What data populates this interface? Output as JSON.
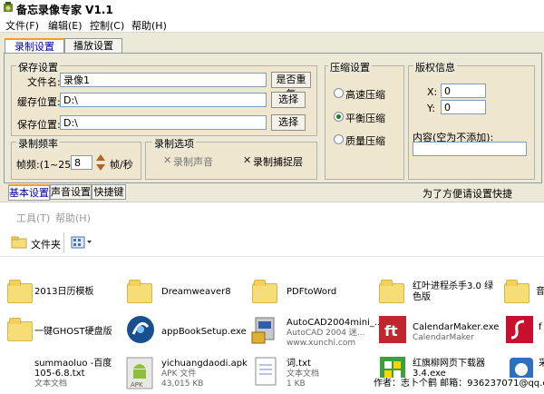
{
  "app": {
    "title": "备忘录像专家 V1.1",
    "menu": [
      "文件(F)",
      "编辑(E)",
      "控制(C)",
      "帮助(H)"
    ],
    "tabs": [
      "录制设置",
      "播放设置"
    ],
    "save_settings": {
      "group_title": "保存设置",
      "filename_label": "文件名:",
      "filename_value": "录像1",
      "rename_button": "是否重复",
      "cache_label": "缓存位置:",
      "cache_value": "D:\\",
      "cache_browse": "选择",
      "save_label": "保存位置:",
      "save_value": "D:\\",
      "save_browse": "选择"
    },
    "framerate": {
      "group_title": "录制频率",
      "label": "帧频:(1~25)",
      "value": "8",
      "unit": "帧/秒"
    },
    "record_options": {
      "group_title": "录制选项",
      "sound": "录制声音",
      "cursor": "录制捕捉层"
    },
    "compression": {
      "group_title": "压缩设置",
      "options": [
        "高速压缩",
        "平衡压缩",
        "质量压缩"
      ],
      "selected": "平衡压缩"
    },
    "copyright": {
      "group_title": "版权信息",
      "x_label": "X:",
      "x_value": "0",
      "y_label": "Y:",
      "y_value": "0",
      "content_label": "内容(空为不添加):",
      "content_value": ""
    },
    "subtabs": [
      "基本设置",
      "声音设置",
      "快捷键"
    ],
    "hint": "为了方便请设置快捷键！！！"
  },
  "explorer": {
    "menu": [
      "工具(T)",
      "帮助(H)"
    ],
    "toolbar": {
      "folders": "文件夹"
    },
    "rows": [
      [
        {
          "name": "2013日历模板",
          "sub": "",
          "icon": "folder-icon"
        },
        {
          "name": "Dreamweaver8",
          "sub": "",
          "icon": "folder-icon"
        },
        {
          "name": "PDFtoWord",
          "sub": "",
          "icon": "folder-icon"
        },
        {
          "name": "红叶进程杀手3.0 绿色版",
          "sub": "",
          "icon": "folder-icon"
        },
        {
          "name": "音",
          "sub": "",
          "icon": "folder-icon"
        }
      ],
      [
        {
          "name": "一键GHOST硬盘版",
          "sub": "",
          "icon": "folder-icon"
        },
        {
          "name": "appBookSetup.exe",
          "sub": "",
          "icon": "setup-icon"
        },
        {
          "name": "AutoCAD2004mini_...",
          "sub": "AutoCAD 2004 迷...",
          "sub2": "www.xunchi.com",
          "icon": "installer-icon"
        },
        {
          "name": "CalendarMaker.exe",
          "sub": "CalendarMaker",
          "icon": "calendar-app-icon"
        },
        {
          "name": "f",
          "sub": "",
          "icon": "flash-icon"
        }
      ],
      [
        {
          "name": "summaoluo -百度",
          "sub": "105-6.8.txt",
          "sub2": "文本文档",
          "icon": "text-file-icon"
        },
        {
          "name": "yichuangdaodi.apk",
          "sub": "APK 文件",
          "sub2": "43,015 KB",
          "icon": "apk-icon"
        },
        {
          "name": "词.txt",
          "sub": "文本文档",
          "sub2": "1 KB",
          "icon": "text-file-icon"
        },
        {
          "name": "红旗柳网页下载器",
          "sub": "3.4.exe",
          "icon": "downloader-icon"
        },
        {
          "name": "采",
          "sub": "",
          "icon": "app-icon"
        }
      ]
    ],
    "credit": "作者：志卜个鹤  邮箱：936237071@qq.com"
  }
}
